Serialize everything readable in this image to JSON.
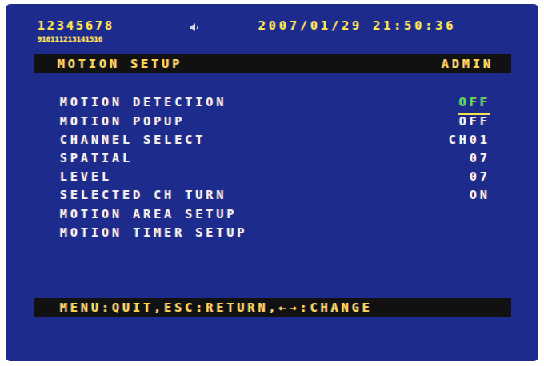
{
  "status": {
    "channels_row1": "12345678",
    "channels_row2": "910111213141516",
    "datetime": "2007/01/29  21:50:36"
  },
  "menu": {
    "title": "MOTION SETUP",
    "user": "ADMIN",
    "items": [
      {
        "label": "MOTION DETECTION",
        "value": "OFF"
      },
      {
        "label": "MOTION POPUP",
        "value": "OFF"
      },
      {
        "label": "CHANNEL SELECT",
        "value": "CH01"
      },
      {
        "label": "SPATIAL",
        "value": "07"
      },
      {
        "label": "LEVEL",
        "value": "07"
      },
      {
        "label": "SELECTED CH TURN",
        "value": "ON"
      },
      {
        "label": "MOTION AREA  SETUP",
        "value": ""
      },
      {
        "label": "MOTION TIMER SETUP",
        "value": ""
      }
    ],
    "selected_index": 0
  },
  "footer": {
    "help": "MENU:QUIT,ESC:RETURN,←→:CHANGE"
  },
  "colors": {
    "background": "#1d2c8c",
    "bar": "#111111",
    "accent": "#ffd64a",
    "selection": "#54e04e"
  },
  "icons": {
    "audio": "speaker-icon"
  }
}
